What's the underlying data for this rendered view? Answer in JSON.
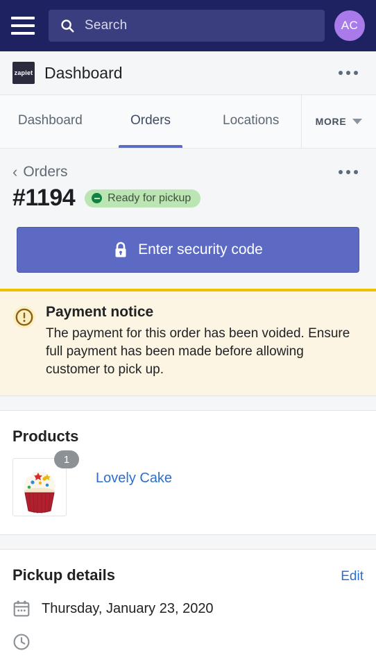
{
  "topbar": {
    "menu_icon": "hamburger-icon",
    "search_icon": "search-icon",
    "search_placeholder": "Search",
    "search_value": "",
    "avatar_initials": "AC"
  },
  "appheader": {
    "logo_text": "zapiet",
    "title": "Dashboard",
    "more_icon": "ellipsis-icon"
  },
  "tabs": {
    "items": [
      {
        "label": "Dashboard",
        "active": false
      },
      {
        "label": "Orders",
        "active": true
      },
      {
        "label": "Locations",
        "active": false
      }
    ],
    "more_label": "MORE",
    "more_caret_icon": "chevron-down-icon"
  },
  "order": {
    "breadcrumb_icon": "chevron-left-icon",
    "breadcrumb_label": "Orders",
    "page_more_icon": "ellipsis-icon",
    "number": "#1194",
    "status_badge": "Ready for pickup",
    "status_icon": "circle-minus-icon",
    "primary_action_icon": "lock-icon",
    "primary_action_label": "Enter security code"
  },
  "notice": {
    "icon": "alert-circle-icon",
    "title": "Payment notice",
    "body": "The payment for this order has been voided. Ensure full payment has been made before allowing customer to pick up."
  },
  "products": {
    "title": "Products",
    "items": [
      {
        "name": "Lovely Cake",
        "quantity": "1",
        "thumbnail_icon": "cupcake-image"
      }
    ]
  },
  "pickup": {
    "title": "Pickup details",
    "edit_label": "Edit",
    "date_icon": "calendar-icon",
    "date": "Thursday, January 23, 2020",
    "time_icon": "clock-icon"
  },
  "colors": {
    "topbar_bg": "#1f2260",
    "search_bg": "#3b3e7e",
    "avatar_bg": "#a97aea",
    "accent_primary": "#5c6ac4",
    "badge_bg": "#bbe5b3",
    "badge_fg": "#108043",
    "notice_bg": "#fcf5e4",
    "notice_border": "#eec200",
    "link": "#2c6ecb",
    "page_bg": "#f4f6f8"
  }
}
